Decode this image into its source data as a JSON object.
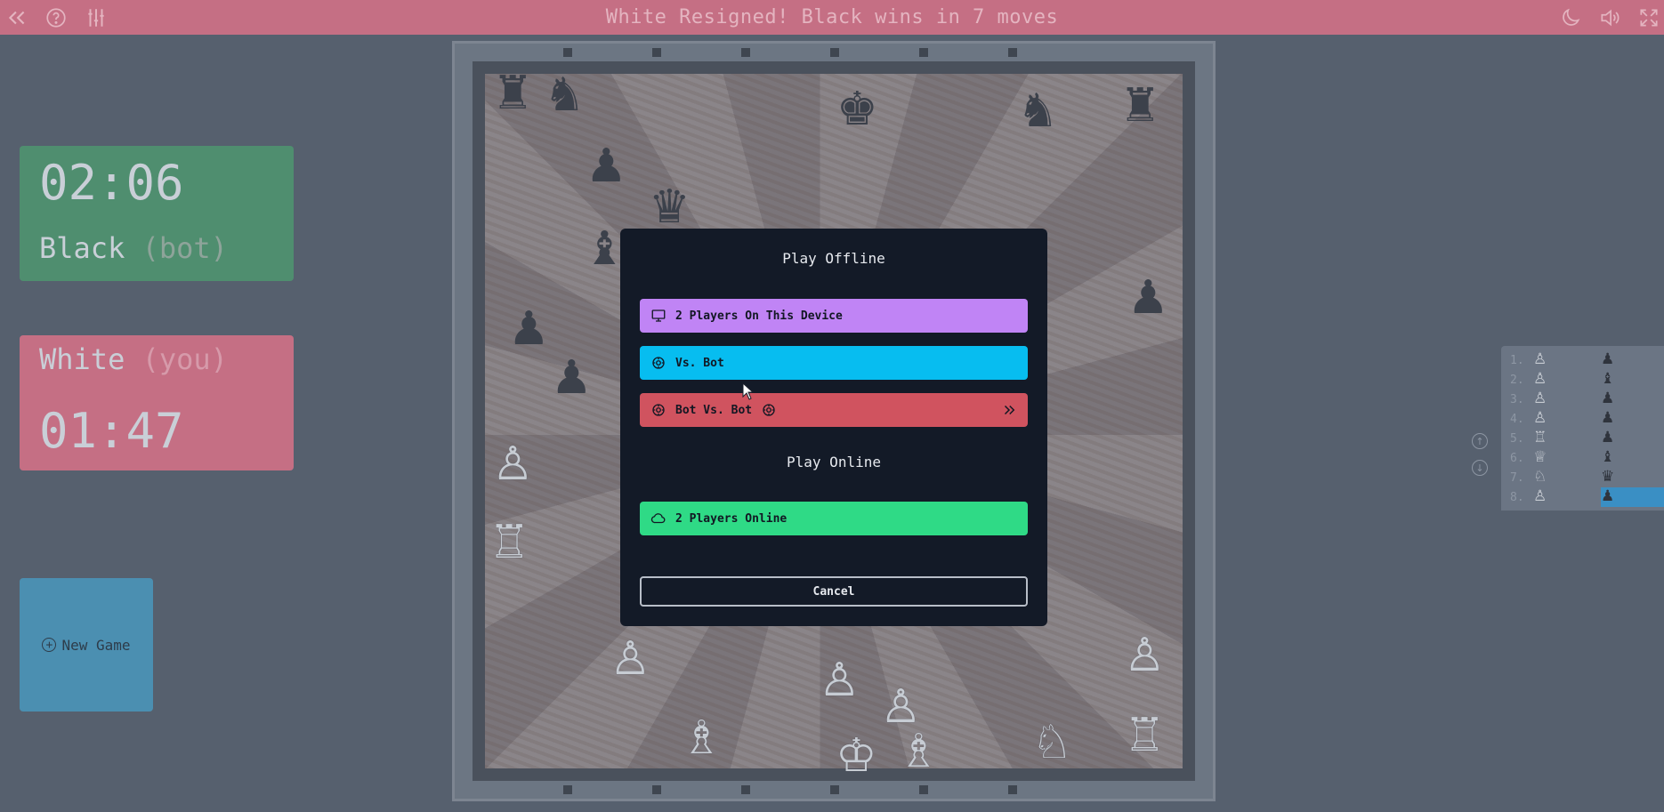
{
  "header": {
    "title": "White Resigned! Black wins in 7 moves",
    "icons": [
      "chevrons-left-icon",
      "help-icon",
      "settings-sliders-icon",
      "moon-icon",
      "volume-icon",
      "fullscreen-icon"
    ]
  },
  "clocks": {
    "black": {
      "time": "02:06",
      "name": "Black",
      "tag": "(bot)"
    },
    "white": {
      "time": "01:47",
      "name": "White",
      "tag": "(you)"
    }
  },
  "new_game": {
    "label": "New Game"
  },
  "move_list": {
    "rows": [
      {
        "num": "1.",
        "white": "♙",
        "black": "♟"
      },
      {
        "num": "2.",
        "white": "♙",
        "black": "♝"
      },
      {
        "num": "3.",
        "white": "♙",
        "black": "♟"
      },
      {
        "num": "4.",
        "white": "♙",
        "black": "♟"
      },
      {
        "num": "5.",
        "white": "♖",
        "black": "♟"
      },
      {
        "num": "6.",
        "white": "♕",
        "black": "♝"
      },
      {
        "num": "7.",
        "white": "♘",
        "black": "♛"
      },
      {
        "num": "8.",
        "white": "♙",
        "black": "♟"
      }
    ],
    "active_row": 8
  },
  "modal": {
    "offline_title": "Play Offline",
    "btn_two_players": "2 Players On This Device",
    "btn_vs_bot": "Vs. Bot",
    "btn_bot_vs_bot": "Bot Vs. Bot",
    "online_title": "Play Online",
    "btn_online": "2 Players Online",
    "cancel": "Cancel"
  },
  "colors": {
    "topbar": "#c56f84",
    "black_clock": "#4f8e6f",
    "white_clock": "#c56f84",
    "new_game": "#4b8fb1",
    "btn_purple": "#c084f5",
    "btn_cyan": "#07bdf0",
    "btn_red": "#d0535f",
    "btn_green": "#2fda86",
    "modal_bg": "#131a27"
  }
}
